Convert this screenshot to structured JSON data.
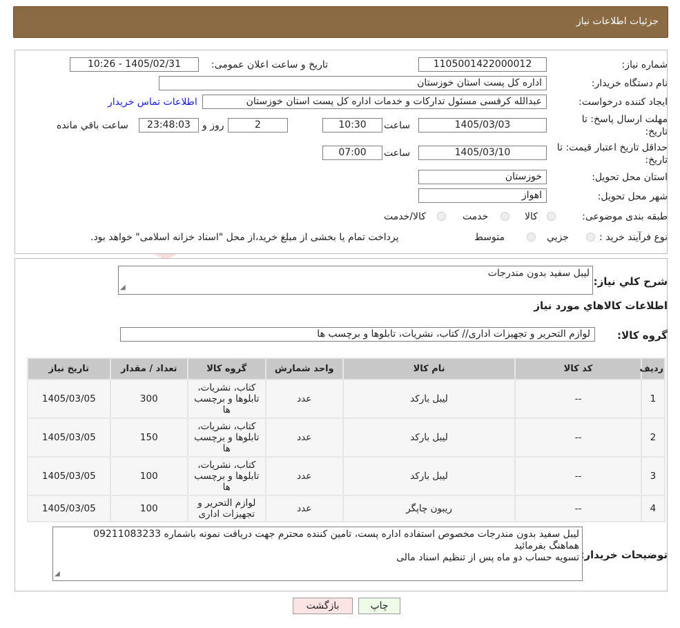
{
  "header": {
    "title": "جزئیات اطلاعات نیاز"
  },
  "watermark": {
    "text": "AriaTender.neT"
  },
  "form": {
    "need_number": {
      "label": "شماره نیاز:",
      "value": "1105001422000012"
    },
    "announce_datetime": {
      "label": "تاریخ و ساعت اعلان عمومی:",
      "value": "1405/02/31 - 10:26"
    },
    "buyer_org": {
      "label": "نام دستگاه خریدار:",
      "value": "اداره کل پست استان خوزستان"
    },
    "requester": {
      "label": "ایجاد کننده درخواست:",
      "value": "عبدالله کرفسی مسئول تدارکات و خدمات اداره کل پست استان خوزستان",
      "contact_link": "اطلاعات تماس خریدار"
    },
    "deadline": {
      "label_line1": "مهلت ارسال پاسخ: تا",
      "label_line2": "تاریخ:",
      "date": "1405/03/03",
      "time_label": "ساعت",
      "time": "10:30",
      "days": "2",
      "days_label": "روز و",
      "remaining": "23:48:03",
      "remaining_label": "ساعت باقي مانده"
    },
    "price_validity": {
      "label_line1": "حداقل تاریخ اعتبار قیمت: تا",
      "label_line2": "تاریخ:",
      "date": "1405/03/10",
      "time_label": "ساعت",
      "time": "07:00"
    },
    "province": {
      "label": "استان محل تحویل:",
      "value": "خوزستان"
    },
    "city": {
      "label": "شهر محل تحویل:",
      "value": "اهواز"
    },
    "category": {
      "label": "طبقه بندی موضوعی:",
      "options": [
        "کالا",
        "خدمت",
        "کالا/خدمت"
      ]
    },
    "process": {
      "label": "نوع فرآیند خرید :",
      "options": [
        "جزیي",
        "متوسط"
      ],
      "note": "پرداخت تمام یا بخشی از مبلغ خرید،از محل \"اسناد خزانه اسلامی\" خواهد بود."
    }
  },
  "description": {
    "label": "شرح کلي نياز:",
    "value": "لیبل سفید بدون مندرجات"
  },
  "items_section": {
    "title": "اطلاعات کالاهاي مورد نياز",
    "group_label": "گروه کالا:",
    "group_value": "لوازم التحریر و تجهیزات اداری// کتاب، نشریات، تابلوها و برچسب ها"
  },
  "table": {
    "headers": [
      "ردیف",
      "کد کالا",
      "نام کالا",
      "واحد شمارش",
      "گروه کالا",
      "تعداد / مقدار",
      "تاریخ نیاز"
    ],
    "rows": [
      {
        "row": "1",
        "code": "--",
        "name": "لیبل بارکد",
        "unit": "عدد",
        "group": "کتاب، نشریات، تابلوها و برچسب ها",
        "qty": "300",
        "date": "1405/03/05"
      },
      {
        "row": "2",
        "code": "--",
        "name": "لیبل بارکد",
        "unit": "عدد",
        "group": "کتاب، نشریات، تابلوها و برچسب ها",
        "qty": "150",
        "date": "1405/03/05"
      },
      {
        "row": "3",
        "code": "--",
        "name": "لیبل بارکد",
        "unit": "عدد",
        "group": "کتاب، نشریات، تابلوها و برچسب ها",
        "qty": "100",
        "date": "1405/03/05"
      },
      {
        "row": "4",
        "code": "--",
        "name": "ریبون چاپگر",
        "unit": "عدد",
        "group": "لوازم التحریر و تجهیزات اداری",
        "qty": "100",
        "date": "1405/03/05"
      }
    ]
  },
  "buyer_notes": {
    "label": "توضیحات خریدار:",
    "line1": "لیبل سفید بدون مندرجات مخصوص استفاده اداره پست، تامین کننده محترم جهت دریافت نمونه باشماره 09211083233",
    "line2": "هماهنگ بفرمائید",
    "line3": "تسویه حساب دو ماه پس از تنظیم اسناد مالی"
  },
  "buttons": {
    "print": "چاپ",
    "back": "بازگشت"
  },
  "colors": {
    "header_bg": "#8b6b44",
    "back_button_bg": "#fce4e4",
    "print_button_bg": "#eefbe9",
    "link": "#1a1ad6"
  }
}
